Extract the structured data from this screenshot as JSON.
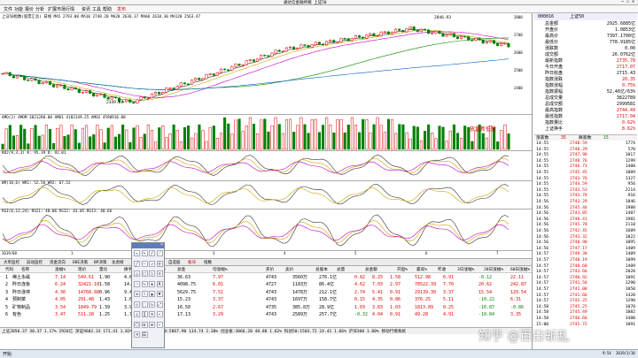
{
  "window": {
    "title": "通达信金融终端 上证50"
  },
  "menu": [
    "文件",
    "功能",
    "报价",
    "分析",
    "扩展市场行情",
    "资讯",
    "工具",
    "帮助",
    "发布"
  ],
  "panes": {
    "main_header": "上证50指数(股票汇总) 日线  MA5 2793.08  MA10 2748.20  MA20 2636.37  MA60 2610.30  MA120 2563.47",
    "vol_header": "AMO(2) AMOM 3821200.00  AMO1 4182149.25  AMO2 4590916.88",
    "kdj_header": "KDJ(9,3,3)  K: 95.39  D: 92.01",
    "wr_header": "WR(10,6)  WR1: 52.56  WR2: 67.52",
    "rsi_header": "RSI(6,12,24)  RSI1: 48.06  RSI2: 43.05  RSI3: 40.66",
    "annot_high": "2846.93",
    "annot_low": "2349.07",
    "annot_callout": "放量新低量",
    "date_axis": [
      "2019/08",
      "1",
      "2",
      "3",
      "4",
      "5",
      "6",
      "7"
    ],
    "price_axis": [
      "2800",
      "2700",
      "2600",
      "2500",
      "2400"
    ]
  },
  "right": {
    "code": "000016",
    "name": "上证50",
    "quote": [
      {
        "label": "总金额",
        "value": "2925.6885亿",
        "c": "blk"
      },
      {
        "label": "开盘价",
        "value": "1.0853亿",
        "c": "blk"
      },
      {
        "label": "最高价",
        "value": "7397.1700亿",
        "c": "blk"
      },
      {
        "label": "最低价",
        "value": "778.9185亿",
        "c": "blk"
      },
      {
        "label": "涨跌数",
        "value": "0.00",
        "c": "blk"
      },
      {
        "label": "成交额",
        "value": "26.0762亿",
        "c": "blk"
      },
      {
        "label": "最新指数",
        "value": "2735.78",
        "c": "red"
      },
      {
        "label": "今日开盘",
        "value": "2717.07",
        "c": "red"
      },
      {
        "label": "昨日收盘",
        "value": "2715.43",
        "c": "blk"
      },
      {
        "label": "指数涨跌",
        "value": "20.35",
        "c": "red"
      },
      {
        "label": "指数涨幅",
        "value": "0.75%",
        "c": "red"
      },
      {
        "label": "指数振幅",
        "value": "52.46亿/63%",
        "c": "blk"
      },
      {
        "label": "总成交量",
        "value": "3822789",
        "c": "blk"
      },
      {
        "label": "总成交额",
        "value": "2999581",
        "c": "blk"
      },
      {
        "label": "最高指数",
        "value": "2744.49",
        "c": "red"
      },
      {
        "label": "最低指数",
        "value": "2717.04",
        "c": "red"
      },
      {
        "label": "指数量比",
        "value": "0.62%",
        "c": "red"
      },
      {
        "label": "上证换手",
        "value": "8.62%",
        "c": "red"
      }
    ],
    "ticks_header": [
      "涨家数",
      "35",
      "跌家数",
      "15"
    ],
    "ticks": [
      {
        "t": "14:55",
        "p": "2748.59",
        "v": "1774"
      },
      {
        "t": "14:55",
        "p": "2748.29",
        "v": "570"
      },
      {
        "t": "14:55",
        "p": "2747.98",
        "v": "1017"
      },
      {
        "t": "14:55",
        "p": "2748.76",
        "v": "1299"
      },
      {
        "t": "14:55",
        "p": "2746.73",
        "v": "1400"
      },
      {
        "t": "14:55",
        "p": "2745.45",
        "v": "1009"
      },
      {
        "t": "14:55",
        "p": "2743.76",
        "v": "1327"
      },
      {
        "t": "14:55",
        "p": "2744.59",
        "v": "956"
      },
      {
        "t": "14:55",
        "p": "2743.53",
        "v": "2214"
      },
      {
        "t": "14:55",
        "p": "2743.78",
        "v": "916"
      },
      {
        "t": "14:56",
        "p": "2743.29",
        "v": "1046"
      },
      {
        "t": "14:56",
        "p": "2745.46",
        "v": "1988"
      },
      {
        "t": "14:56",
        "p": "2743.85",
        "v": "1407"
      },
      {
        "t": "14:56",
        "p": "2748.41",
        "v": "1981"
      },
      {
        "t": "14:56",
        "p": "2745.78",
        "v": "2110"
      },
      {
        "t": "14:56",
        "p": "2742.45",
        "v": "1609"
      },
      {
        "t": "14:56",
        "p": "2743.32",
        "v": "1022"
      },
      {
        "t": "14:56",
        "p": "2748.90",
        "v": "1095"
      },
      {
        "t": "14:56",
        "p": "2747.17",
        "v": "1409"
      },
      {
        "t": "14:57",
        "p": "2749.38",
        "v": "1409"
      },
      {
        "t": "14:57",
        "p": "2748.19",
        "v": "1099"
      },
      {
        "t": "14:57",
        "p": "2748.68",
        "v": "1409"
      },
      {
        "t": "14:57",
        "p": "2743.66",
        "v": "2028"
      },
      {
        "t": "14:57",
        "p": "2740.92",
        "v": "1091"
      },
      {
        "t": "14:57",
        "p": "2741.56",
        "v": "1290"
      },
      {
        "t": "14:57",
        "p": "2741.08",
        "v": "1050"
      },
      {
        "t": "14:57",
        "p": "2741.66",
        "v": "1420"
      },
      {
        "t": "14:57",
        "p": "2742.25",
        "v": "1290"
      },
      {
        "t": "14:58",
        "p": "2745.25",
        "v": "1070"
      },
      {
        "t": "14:58",
        "p": "2745.49",
        "v": "1082"
      },
      {
        "t": "14:58",
        "p": "2746.66",
        "v": "3480"
      },
      {
        "t": "15:00",
        "p": "2745.72",
        "v": "1091"
      }
    ]
  },
  "tabs": [
    "大单监控",
    "异动监控",
    "资金流向",
    "DDE决策",
    "BP决策",
    "龙虎榜",
    "自选股",
    "板块",
    "指数"
  ],
  "table": {
    "headers": [
      "代码",
      "名称",
      "涨幅%",
      "现价",
      "量比",
      "换手率",
      "市盈(动)",
      "总金",
      "均涨幅%",
      "买价",
      "卖价",
      "总股本",
      "总量",
      "总金额",
      "开盘%",
      "最高%",
      "昨收",
      "3日涨幅%",
      "20日涨幅%",
      "60日涨幅%"
    ],
    "rows": [
      {
        "n": "1",
        "name": "稀土永磁",
        "chg": "7.14",
        "price": "549.61",
        "lb": "1.90",
        "hs": "4.65",
        "pe": "36.85",
        "zj": "36.63",
        "jz": "7.97",
        "zgb": "4743",
        "zl": "3560万",
        "ze": "276.1亿",
        "kp": "0.82",
        "zg": "8.25",
        "zs": "1.58",
        "sr": "512.98",
        "d3": "6.91",
        "d20": "-8.12",
        "d60": "22.11"
      },
      {
        "n": "2",
        "name": "昨日连板",
        "chg": "6.24",
        "price": "32421.18",
        "lb": "1.58",
        "hs": "14.00",
        "pe": "67.15",
        "zj": "4098.75",
        "jz": "6.01",
        "zgb": "4727",
        "zl": "1183万",
        "ze": "86.4亿",
        "kp": "4.62",
        "zg": "7.03",
        "zs": "2.97",
        "sr": "78522.39",
        "d3": "7.70",
        "d20": "20.62",
        "d60": "242.87"
      },
      {
        "n": "3",
        "name": "昨日涨停",
        "chg": "4.36",
        "price": "14768.88",
        "lb": "0.96",
        "hs": "9.47",
        "pe": "78.54",
        "zj": "5629.75",
        "jz": "7.51",
        "zgb": "4743",
        "zl": "1478万",
        "ze": "212.1亿",
        "kp": "2.74",
        "zg": "5.41",
        "zs": "0.91",
        "sr": "29139.30",
        "d3": "3.37",
        "d20": "15.54",
        "d60": "129.54"
      },
      {
        "n": "4",
        "name": "预制菜",
        "chg": "4.05",
        "price": "291.48",
        "lb": "1.43",
        "hs": "1.68",
        "pe": "25.36",
        "zj": "15.23",
        "jz": "3.37",
        "zgb": "4743",
        "zl": "1697万",
        "ze": "158.7亿",
        "kp": "0.15",
        "zg": "4.35",
        "zs": "0.86",
        "sr": "376.25",
        "d3": "5.11",
        "d20": "-10.22",
        "d60": "6.31"
      },
      {
        "n": "5",
        "name": "矿物制品",
        "chg": "3.54",
        "price": "1849.79",
        "lb": "1.39",
        "hs": "3.95",
        "pe": "22.66",
        "zj": "16.50",
        "jz": "2.67",
        "zgb": "4735",
        "zl": "385.8万",
        "ze": "28.9亿",
        "kp": "1.03",
        "zg": "3.83",
        "zs": "1.03",
        "sr": "1813.89",
        "d3": "0.25",
        "d20": "-16.87",
        "d60": "-0.86"
      },
      {
        "n": "6",
        "name": "有色",
        "chg": "3.47",
        "price": "511.28",
        "lb": "1.25",
        "hs": "1.71",
        "pe": "37.88",
        "zj": "17.13",
        "jz": "3.29",
        "zgb": "4743",
        "zl": "2589万",
        "ze": "257.7亿",
        "kp": "-0.32",
        "zg": "4.04",
        "zs": "0.91",
        "sr": "49.28",
        "d3": "4.91",
        "d20": "-10.84",
        "d60": "3.35"
      }
    ]
  },
  "status": "上证2850.37  30.37  1.17%  2926亿   深证9602.33  171.41  1.82%  2761亿  中小100:5867.90  134.74  2.30%  创业板:3066.20  48.80  1.62%  科创50:1503.72  24.41  1.66%  沪深300 1.00%  移动行情系统",
  "taskbar": {
    "start": "开始",
    "time": "9:54",
    "date": "2019/3/18"
  },
  "watermark": "知乎 @百日斩乱",
  "colors": {
    "up": "#e00000",
    "down": "#008000",
    "bg": "#ffffff"
  }
}
